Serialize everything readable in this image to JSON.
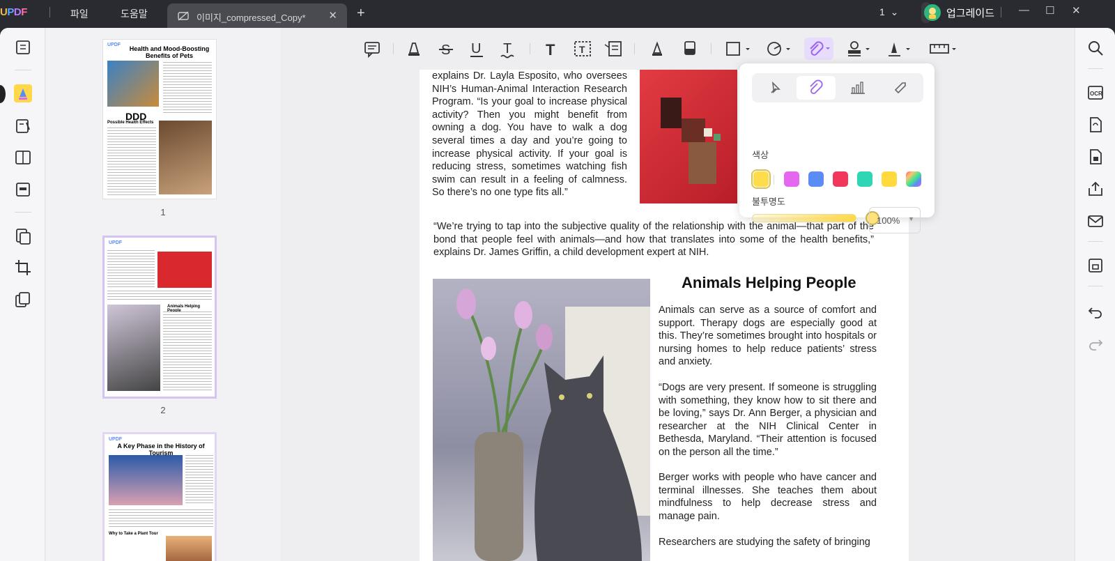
{
  "app": {
    "logo": "UPDF",
    "menu": [
      "파일",
      "도움말"
    ],
    "tab_title": "이미지_compressed_Copy*",
    "page_selector": "1",
    "upgrade_label": "업그레이드"
  },
  "thumbnails": [
    {
      "number": "1",
      "logo": "UPDF",
      "title": "Health and Mood-Boosting Benefits of Pets",
      "annotation": "DDD",
      "subheading": "Possible Health Effects"
    },
    {
      "number": "2",
      "logo": "UPDF",
      "subheading": "Animals Helping People"
    },
    {
      "number": "",
      "logo": "UPDF",
      "title": "A Key Phase in the History of Tourism",
      "subheading": "Why to Take a Plant Tour"
    }
  ],
  "toolbar_icons": [
    "comment-icon",
    "highlight-icon",
    "strikethrough-icon",
    "underline-icon",
    "squiggly-icon",
    "text-icon",
    "textbox-icon",
    "callout-icon",
    "pencil-icon",
    "eraser-icon",
    "rectangle-icon",
    "shape-icon",
    "attachment-icon",
    "stamp-icon",
    "signature-icon",
    "measure-icon"
  ],
  "document": {
    "para1": "explains Dr. Layla Esposito, who oversees NIH’s Human-Animal Interaction Research Program. “Is your goal to increase physical activity? Then you might benefit from owning a dog. You have to walk a dog several times a day and you’re going to increase physical activity. If your goal is reducing stress, sometimes watching fish swim can result in a feeling of calmness. So there’s no one type fits all.”",
    "para2": "“We’re trying to tap into the subjective quality of the relationship with the animal—that part of the bond that people feel with animals—and how that translates into some of the health benefits,” explains Dr. James Griffin, a child development expert at NIH.",
    "heading": "Animals Helping People",
    "para3": "Animals can serve as a source of comfort and support. Therapy dogs are especially good at this. They’re sometimes brought into hospitals or nursing homes to help reduce patients’ stress and anxiety.",
    "para4": "“Dogs are very present. If someone is struggling with something, they know how to sit there and be loving,” says Dr. Ann Berger, a physician and researcher at the NIH Clinical Center in Bethesda, Maryland. “Their attention is focused on the person all the time.”",
    "para5": "Berger works with people who have cancer and terminal illnesses. She teaches them about mindfulness to help decrease stress and manage pain.",
    "para6": "Researchers are studying the safety of bringing"
  },
  "popup": {
    "tabs": [
      "pin-icon",
      "paperclip-icon",
      "chart-icon",
      "tag-icon"
    ],
    "active_tab": 1,
    "color_label": "색상",
    "colors": [
      "#ffdc4a",
      "#e566f0",
      "#5b8cf5",
      "#f2375c",
      "#2fd6b5",
      "#ffd93d",
      "rainbow"
    ],
    "selected_color": 0,
    "opacity_label": "불투명도",
    "opacity_value": "100%",
    "opacity_fraction": 1.0
  }
}
